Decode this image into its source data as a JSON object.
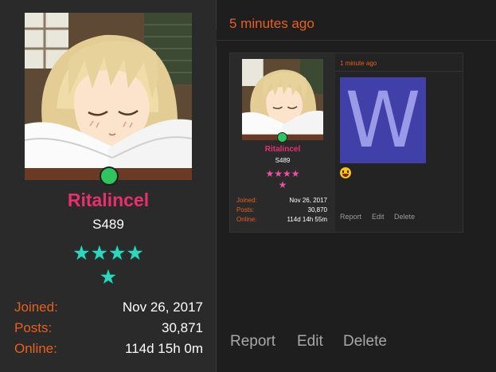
{
  "post": {
    "author": {
      "username": "Ritalincel",
      "title": "S489",
      "stars_row1": "★★★★",
      "stars_row2": "★",
      "stats": [
        {
          "label": "Joined:",
          "value": "Nov 26, 2017"
        },
        {
          "label": "Posts:",
          "value": "30,871"
        },
        {
          "label": "Online:",
          "value": "114d 15h 0m"
        }
      ]
    },
    "timestamp": "5 minutes ago",
    "actions": {
      "report": "Report",
      "edit": "Edit",
      "delete": "Delete"
    }
  },
  "quoted_post": {
    "author": {
      "username": "Ritalincel",
      "title": "S489",
      "stars_row1": "★★★★",
      "stars_row2": "★",
      "stats": [
        {
          "label": "Joined:",
          "value": "Nov 26, 2017"
        },
        {
          "label": "Posts:",
          "value": "30,870"
        },
        {
          "label": "Online:",
          "value": "114d 14h 55m"
        }
      ]
    },
    "timestamp": "1 minute ago",
    "image_letter": "W",
    "actions": {
      "report": "Report",
      "edit": "Edit",
      "delete": "Delete"
    }
  },
  "colors": {
    "username": "#e8306f",
    "labels": "#e8601c",
    "online": "#2ec55e",
    "stars_main": "#2fd6bd",
    "stars_quote": "#f04fa4",
    "image_bg": "#4040a8"
  },
  "icons": {
    "emoji": "grinning-tongue-emoji",
    "online": "online-status-dot"
  }
}
